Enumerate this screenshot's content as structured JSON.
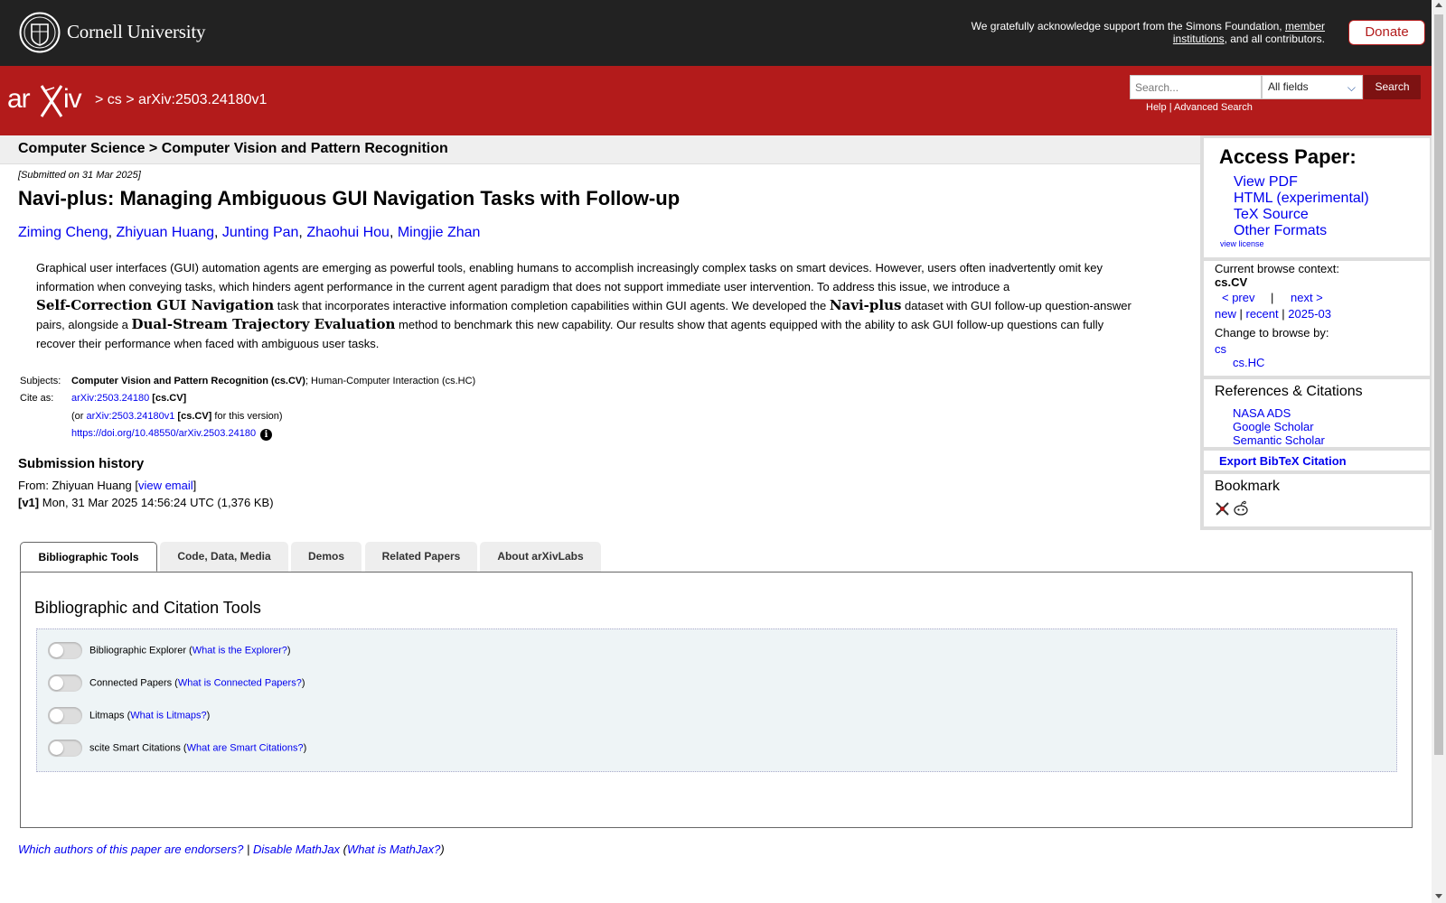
{
  "header": {
    "university": "Cornell University",
    "support_prefix": "We gratefully acknowledge support from the Simons Foundation,",
    "support_link": "member institutions",
    "support_suffix": ", and all contributors.",
    "donate": "Donate"
  },
  "nav": {
    "crumb_sep1": ">",
    "crumb_cs": "cs",
    "crumb_sep2": ">",
    "crumb_id": "arXiv:2503.24180v1",
    "search_placeholder": "Search...",
    "field_select": "All fields",
    "search_button": "Search",
    "help": "Help",
    "help_sep": "|",
    "advanced": "Advanced Search"
  },
  "paper": {
    "subject_header": "Computer Science > Computer Vision and Pattern Recognition",
    "submitted": "[Submitted on 31 Mar 2025]",
    "title": "Navi-plus: Managing Ambiguous GUI Navigation Tasks with Follow-up",
    "authors": [
      "Ziming Cheng",
      "Zhiyuan Huang",
      "Junting Pan",
      "Zhaohui Hou",
      "Mingjie Zhan"
    ],
    "abstract_lines": [
      "Graphical user interfaces (GUI) automation agents are emerging as powerful tools, enabling humans to accomplish increasingly complex tasks on smart devices. However, users often inadvertently omit key",
      "information when conveying tasks, which hinders agent performance in the current agent paradigm that does not support immediate user intervention. To address this issue, we introduce a"
    ],
    "abstract_math1": "Self-Correction GUI Navigation",
    "abstract_mid1": " task that incorporates interactive information completion capabilities within GUI agents. We developed the ",
    "abstract_math2": "Navi-plus",
    "abstract_mid2": " dataset with GUI follow-up question-answer",
    "abstract_line4_pre": "pairs, alongside a ",
    "abstract_math3": "Dual-Stream Trajectory Evaluation",
    "abstract_line4_post": " method to benchmark this new capability. Our results show that agents equipped with the ability to ask GUI follow-up questions can fully",
    "abstract_line5": "recover their performance when faced with ambiguous user tasks.",
    "subjects_label": "Subjects:",
    "subjects_primary": "Computer Vision and Pattern Recognition (cs.CV)",
    "subjects_secondary": "; Human-Computer Interaction (cs.HC)",
    "cite_label": "Cite as:",
    "cite_id": "arXiv:2503.24180",
    "cite_cat": "[cs.CV]",
    "cite_or": "(or ",
    "cite_version_id": "arXiv:2503.24180v1",
    "cite_version_cat": "[cs.CV]",
    "cite_version_suffix": "for this version)",
    "doi": "https://doi.org/10.48550/arXiv.2503.24180",
    "history_title": "Submission history",
    "history_from": "From: Zhiyuan Huang [",
    "history_email": "view email",
    "history_close": "]",
    "history_version": "[v1]",
    "history_date": "Mon, 31 Mar 2025 14:56:24 UTC (1,376 KB)"
  },
  "sidebar": {
    "access_title": "Access Paper:",
    "access_links": [
      "View PDF",
      "HTML (experimental)",
      "TeX Source",
      "Other Formats"
    ],
    "view_license": "view license",
    "context_label": "Current browse context:",
    "context_value": "cs.CV",
    "prev": "< prev",
    "sep": "|",
    "next": "next >",
    "new": "new",
    "recent": "recent",
    "month": "2025-03",
    "change_label": "Change to browse by:",
    "browse_cs": "cs",
    "browse_hc": "cs.HC",
    "refs_title": "References & Citations",
    "refs_links": [
      "NASA ADS",
      "Google Scholar",
      "Semantic Scholar"
    ],
    "export": "Export BibTeX Citation",
    "bookmark": "Bookmark"
  },
  "tabs": [
    "Bibliographic Tools",
    "Code, Data, Media",
    "Demos",
    "Related Papers",
    "About arXivLabs"
  ],
  "tools": {
    "title": "Bibliographic and Citation Tools",
    "rows": [
      {
        "label": "Bibliographic Explorer",
        "link": "What is the Explorer?"
      },
      {
        "label": "Connected Papers",
        "link": "What is Connected Papers?"
      },
      {
        "label": "Litmaps",
        "link": "What is Litmaps?"
      },
      {
        "label": "scite Smart Citations",
        "link": "What are Smart Citations?"
      }
    ]
  },
  "footer": {
    "endorsers": "Which authors of this paper are endorsers?",
    "sep": "|",
    "mathjax": "Disable MathJax",
    "what_mathjax": "What is MathJax?"
  }
}
